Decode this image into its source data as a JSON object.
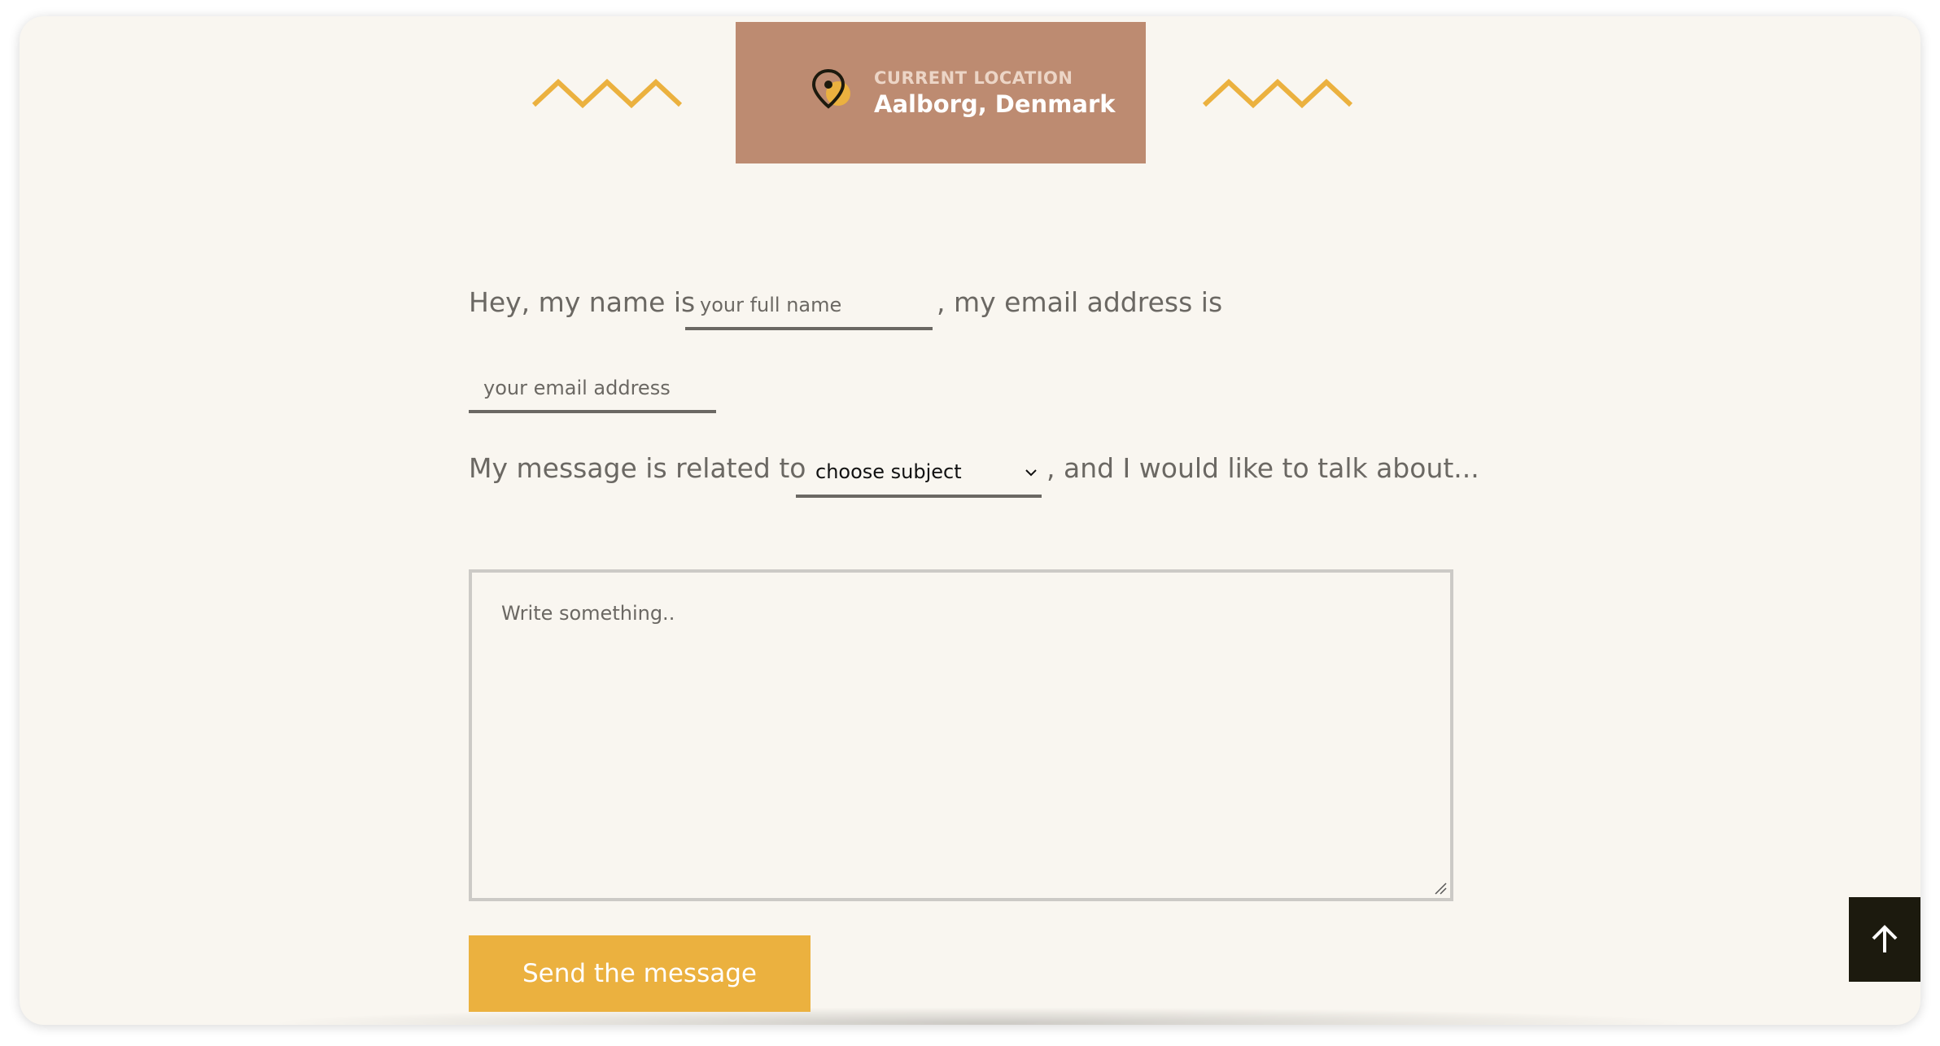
{
  "location": {
    "subtitle": "CURRENT LOCATION",
    "city": "Aalborg, Denmark",
    "icon": "location-pin-icon"
  },
  "form": {
    "intro_name": "Hey, my name is",
    "name_placeholder": "your full name",
    "intro_email": ", my email address is",
    "email_placeholder": "your email address",
    "intro_subject": "My message is related to",
    "subject_value": "choose subject",
    "outro_subject": ", and I would like to talk about...",
    "message_placeholder": "Write something..",
    "send_label": "Send the message"
  },
  "colors": {
    "background": "#f9f6f0",
    "card": "#bd8b71",
    "accent": "#ebb13f",
    "text": "#6b6863",
    "scroll_button": "#1c1a0e"
  }
}
